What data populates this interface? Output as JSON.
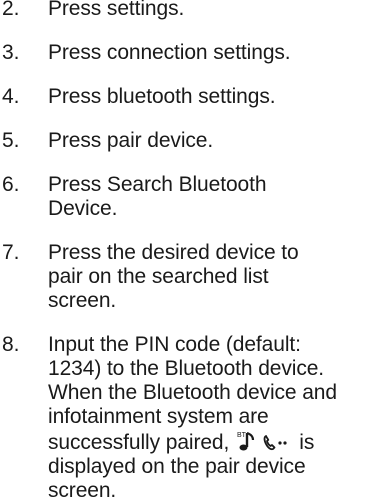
{
  "steps": [
    {
      "number": "2.",
      "lines": [
        "Press settings."
      ]
    },
    {
      "number": "3.",
      "lines": [
        "Press connection settings."
      ]
    },
    {
      "number": "4.",
      "lines": [
        "Press bluetooth settings."
      ]
    },
    {
      "number": "5.",
      "lines": [
        "Press pair device."
      ]
    },
    {
      "number": "6.",
      "lines": [
        "Press Search Bluetooth",
        "Device."
      ]
    },
    {
      "number": "7.",
      "lines": [
        "Press the desired device to",
        "pair on the searched list",
        "screen."
      ]
    },
    {
      "number": "8.",
      "lines": [
        "Input the PIN code (default:",
        "1234) to the Bluetooth device.",
        "When the Bluetooth device and",
        "infotainment system are"
      ],
      "icon_line_before": "successfully paired,",
      "icon_line_after": "is",
      "lines_after": [
        "displayed on the pair device",
        "screen."
      ]
    }
  ],
  "icons": {
    "bt_label": "BT",
    "bluetooth_phone_icon": "bluetooth-phone-connected-icon"
  }
}
